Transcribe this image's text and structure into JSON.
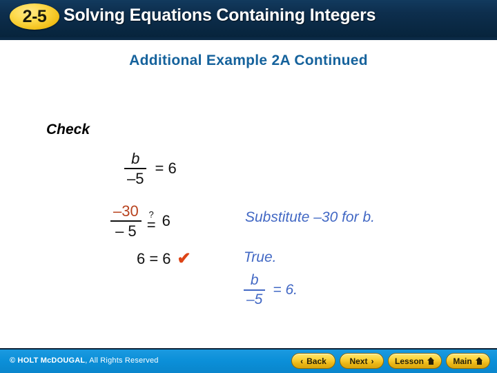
{
  "header": {
    "badge": "2-5",
    "title": "Solving Equations Containing Integers"
  },
  "subtitle": "Additional Example 2A Continued",
  "work": {
    "check_label": "Check",
    "row1": {
      "numerator": "b",
      "denominator": "–5",
      "equals": "= 6"
    },
    "row2": {
      "numerator": "–30",
      "denominator": "– 5",
      "question_mark": "?",
      "equals_sign": "=",
      "right_side": "6"
    },
    "row3": {
      "statement": "6 = 6",
      "check_mark": "✔"
    }
  },
  "annotations": {
    "substitute": "Substitute –30 for b.",
    "true_label": "True.",
    "true_fraction": {
      "numerator": "b",
      "denominator": "–5",
      "equals": "= 6."
    }
  },
  "footer": {
    "copyright_brand": "© HOLT McDOUGAL",
    "copyright_rest": ", All Rights Reserved",
    "buttons": [
      {
        "label": "Back",
        "glyph": "‹",
        "icon": "chevron-left-icon"
      },
      {
        "label": "Next",
        "glyph": "›",
        "icon": "chevron-right-icon"
      },
      {
        "label": "Lesson",
        "glyph": "",
        "icon": "home-icon"
      },
      {
        "label": "Main",
        "glyph": "",
        "icon": "home-icon"
      }
    ]
  },
  "colors": {
    "header_navy": "#0d2e4d",
    "badge_gold": "#fcd239",
    "subtitle_blue": "#15629c",
    "annotation_blue": "#4268c4",
    "highlight_red": "#b8431f",
    "check_orange": "#dd4417",
    "footer_blue": "#0b8fd8"
  }
}
